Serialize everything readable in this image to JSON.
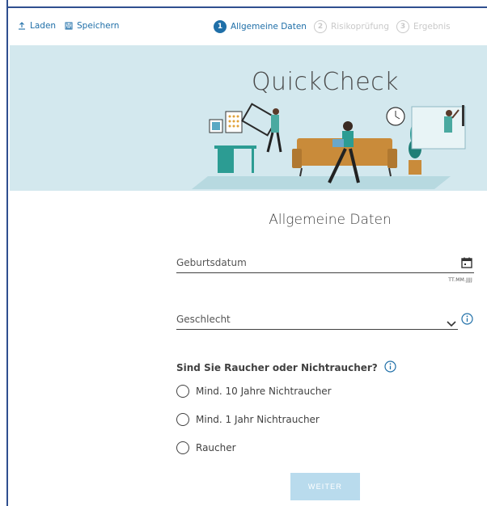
{
  "toolbar": {
    "load_label": "Laden",
    "save_label": "Speichern"
  },
  "steps": [
    {
      "number": "1",
      "label": "Allgemeine Daten",
      "active": true
    },
    {
      "number": "2",
      "label": "Risikoprüfung",
      "active": false
    },
    {
      "number": "3",
      "label": "Ergebnis",
      "active": false
    }
  ],
  "hero": {
    "title": "QuickCheck"
  },
  "form": {
    "section_title": "Allgemeine Daten",
    "birthdate": {
      "label": "Geburtsdatum",
      "hint": "TT.MM.JJJJ"
    },
    "gender": {
      "label": "Geschlecht"
    },
    "smoker": {
      "question": "Sind Sie Raucher oder Nichtraucher?",
      "options": [
        "Mind. 10 Jahre Nichtraucher",
        "Mind. 1 Jahr Nichtraucher",
        "Raucher"
      ]
    },
    "next_label": "WEITER"
  },
  "colors": {
    "primary": "#1f6fa8",
    "hero_bg": "#d3e8ee",
    "button_disabled": "#b9dbed",
    "frame": "#2f4f8f"
  }
}
